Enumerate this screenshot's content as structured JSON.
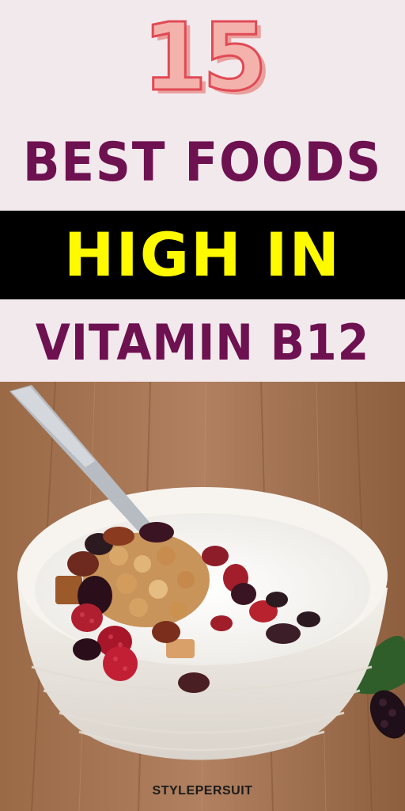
{
  "title": {
    "number": "15",
    "line1": "BEST FOODS",
    "line2": "HIGH IN",
    "line3": "VITAMIN B12"
  },
  "brand": "STYLEPERSUIT",
  "colors": {
    "background": "#f2e9ec",
    "title_purple": "#6e1150",
    "highlight_yellow": "#fffa00",
    "band_black": "#000000",
    "number_pink": "#f4b2ad",
    "number_outline": "#e04a55"
  },
  "photo": {
    "subject": "yogurt-bowl-with-granola-and-berries-icon"
  }
}
